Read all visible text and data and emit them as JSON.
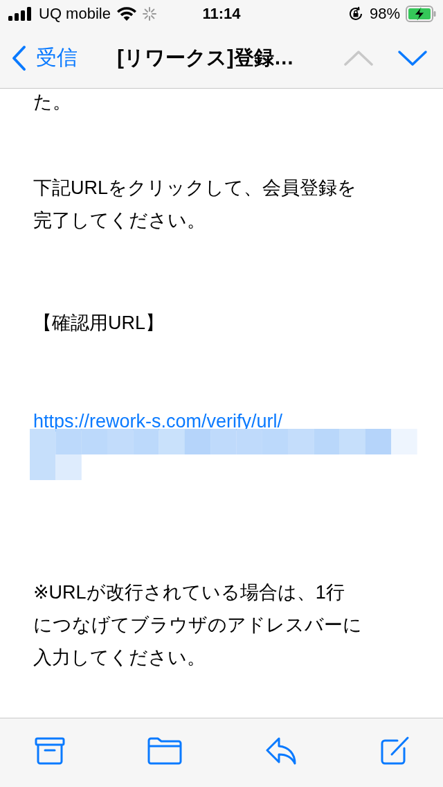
{
  "status_bar": {
    "carrier": "UQ mobile",
    "time": "11:14",
    "battery_percent": "98%",
    "charging": true
  },
  "nav": {
    "back_label": "受信",
    "title": "[リワークス]登録…",
    "previous": {
      "disabled": true
    },
    "next": {
      "disabled": false
    }
  },
  "body": [
    {
      "kind": "text",
      "lines": [
        "た。"
      ]
    },
    {
      "kind": "text",
      "lines": [
        "下記URLをクリックして、会員登録を",
        "完了してください。"
      ]
    },
    {
      "kind": "text",
      "lines": [
        "【確認用URL】"
      ]
    },
    {
      "kind": "link",
      "lines": [
        "https://rework-s.com/verify/url/"
      ],
      "redacted": true
    },
    {
      "kind": "text",
      "lines": [
        "※URLが改行されている場合は、1行",
        "につなげてブラウザのアドレスバーに",
        "入力してください。"
      ]
    }
  ],
  "toolbar": [
    {
      "kind": "archive"
    },
    {
      "kind": "folder"
    },
    {
      "kind": "reply"
    },
    {
      "kind": "compose"
    }
  ]
}
